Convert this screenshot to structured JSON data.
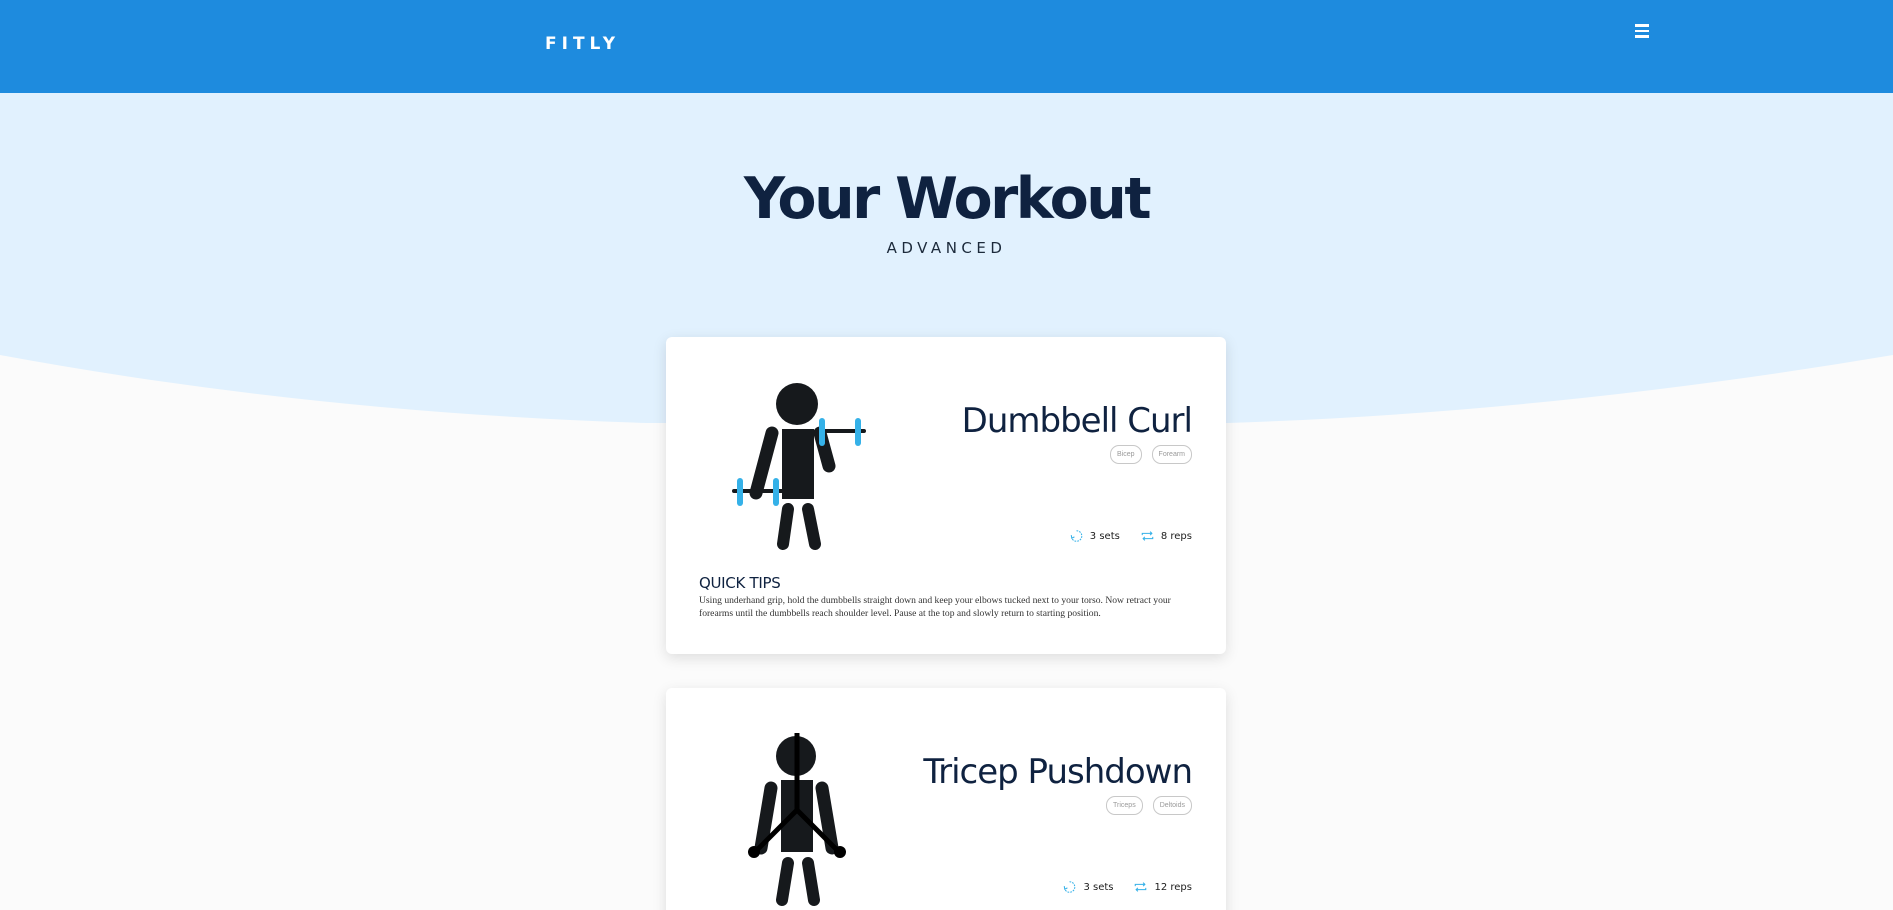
{
  "brand": "FITLY",
  "hero": {
    "title": "Your Workout",
    "subtitle": "ADVANCED"
  },
  "colors": {
    "nav": "#1e8bde",
    "hero_bg": "#e1f1fe",
    "accent": "#35b1e8",
    "figure": "#16191c",
    "title_text": "#0f2240"
  },
  "icons": {
    "menu": "hamburger-menu-icon",
    "sets": "cycle-icon",
    "reps": "repeat-icon"
  },
  "exercises": [
    {
      "name": "Dumbbell Curl",
      "tags": [
        "Bicep",
        "Forearm"
      ],
      "sets": "3 sets",
      "reps": "8 reps",
      "tips_title": "QUICK TIPS",
      "tips": "Using underhand grip, hold the dumbbells straight down and keep your elbows tucked next to your torso. Now retract your forearms until the dumbbells reach shoulder level. Pause at the top and slowly return to starting position."
    },
    {
      "name": "Tricep Pushdown",
      "tags": [
        "Triceps",
        "Deltoids"
      ],
      "sets": "3 sets",
      "reps": "12 reps"
    }
  ]
}
